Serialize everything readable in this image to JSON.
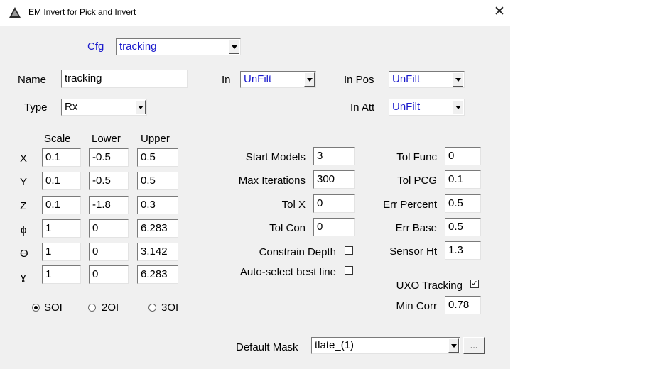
{
  "window": {
    "title": "EM Invert for Pick and Invert",
    "close_glyph": "✕"
  },
  "cfg": {
    "label": "Cfg",
    "value": "tracking"
  },
  "name": {
    "label": "Name",
    "value": "tracking"
  },
  "type": {
    "label": "Type",
    "value": "Rx"
  },
  "in": {
    "label": "In",
    "value": "UnFilt"
  },
  "in_pos": {
    "label": "In Pos",
    "value": "UnFilt"
  },
  "in_att": {
    "label": "In Att",
    "value": "UnFilt"
  },
  "params": {
    "headers": {
      "scale": "Scale",
      "lower": "Lower",
      "upper": "Upper"
    },
    "rows": [
      {
        "label": "X",
        "scale": "0.1",
        "lower": "-0.5",
        "upper": "0.5"
      },
      {
        "label": "Y",
        "scale": "0.1",
        "lower": "-0.5",
        "upper": "0.5"
      },
      {
        "label": "Z",
        "scale": "0.1",
        "lower": "-1.8",
        "upper": "0.3"
      },
      {
        "label": "ϕ",
        "scale": "1",
        "lower": "0",
        "upper": "6.283"
      },
      {
        "label": "ϴ",
        "scale": "1",
        "lower": "0",
        "upper": "3.142"
      },
      {
        "label": "ɣ",
        "scale": "1",
        "lower": "0",
        "upper": "6.283"
      }
    ]
  },
  "solver": {
    "start_models": {
      "label": "Start Models",
      "value": "3"
    },
    "max_iterations": {
      "label": "Max Iterations",
      "value": "300"
    },
    "tol_x": {
      "label": "Tol X",
      "value": "0"
    },
    "tol_con": {
      "label": "Tol Con",
      "value": "0"
    },
    "constrain_depth": {
      "label": "Constrain Depth",
      "checked": false
    },
    "auto_select": {
      "label": "Auto-select best line",
      "checked": false
    }
  },
  "tolerances": {
    "tol_func": {
      "label": "Tol Func",
      "value": "0"
    },
    "tol_pcg": {
      "label": "Tol PCG",
      "value": "0.1"
    },
    "err_percent": {
      "label": "Err Percent",
      "value": "0.5"
    },
    "err_base": {
      "label": "Err Base",
      "value": "0.5"
    },
    "sensor_ht": {
      "label": "Sensor Ht",
      "value": "1.3"
    }
  },
  "uxo_tracking": {
    "label": "UXO Tracking",
    "checked": true,
    "check_glyph": "✓"
  },
  "min_corr": {
    "label": "Min Corr",
    "value": "0.78"
  },
  "order": {
    "options": [
      {
        "label": "SOI",
        "selected": true
      },
      {
        "label": "2OI",
        "selected": false
      },
      {
        "label": "3OI",
        "selected": false
      }
    ]
  },
  "default_mask": {
    "label": "Default Mask",
    "value": "tlate_(1)",
    "browse_label": "..."
  },
  "colors": {
    "dialog_bg": "#f0f0f0",
    "accent_text": "#1a1acc"
  }
}
